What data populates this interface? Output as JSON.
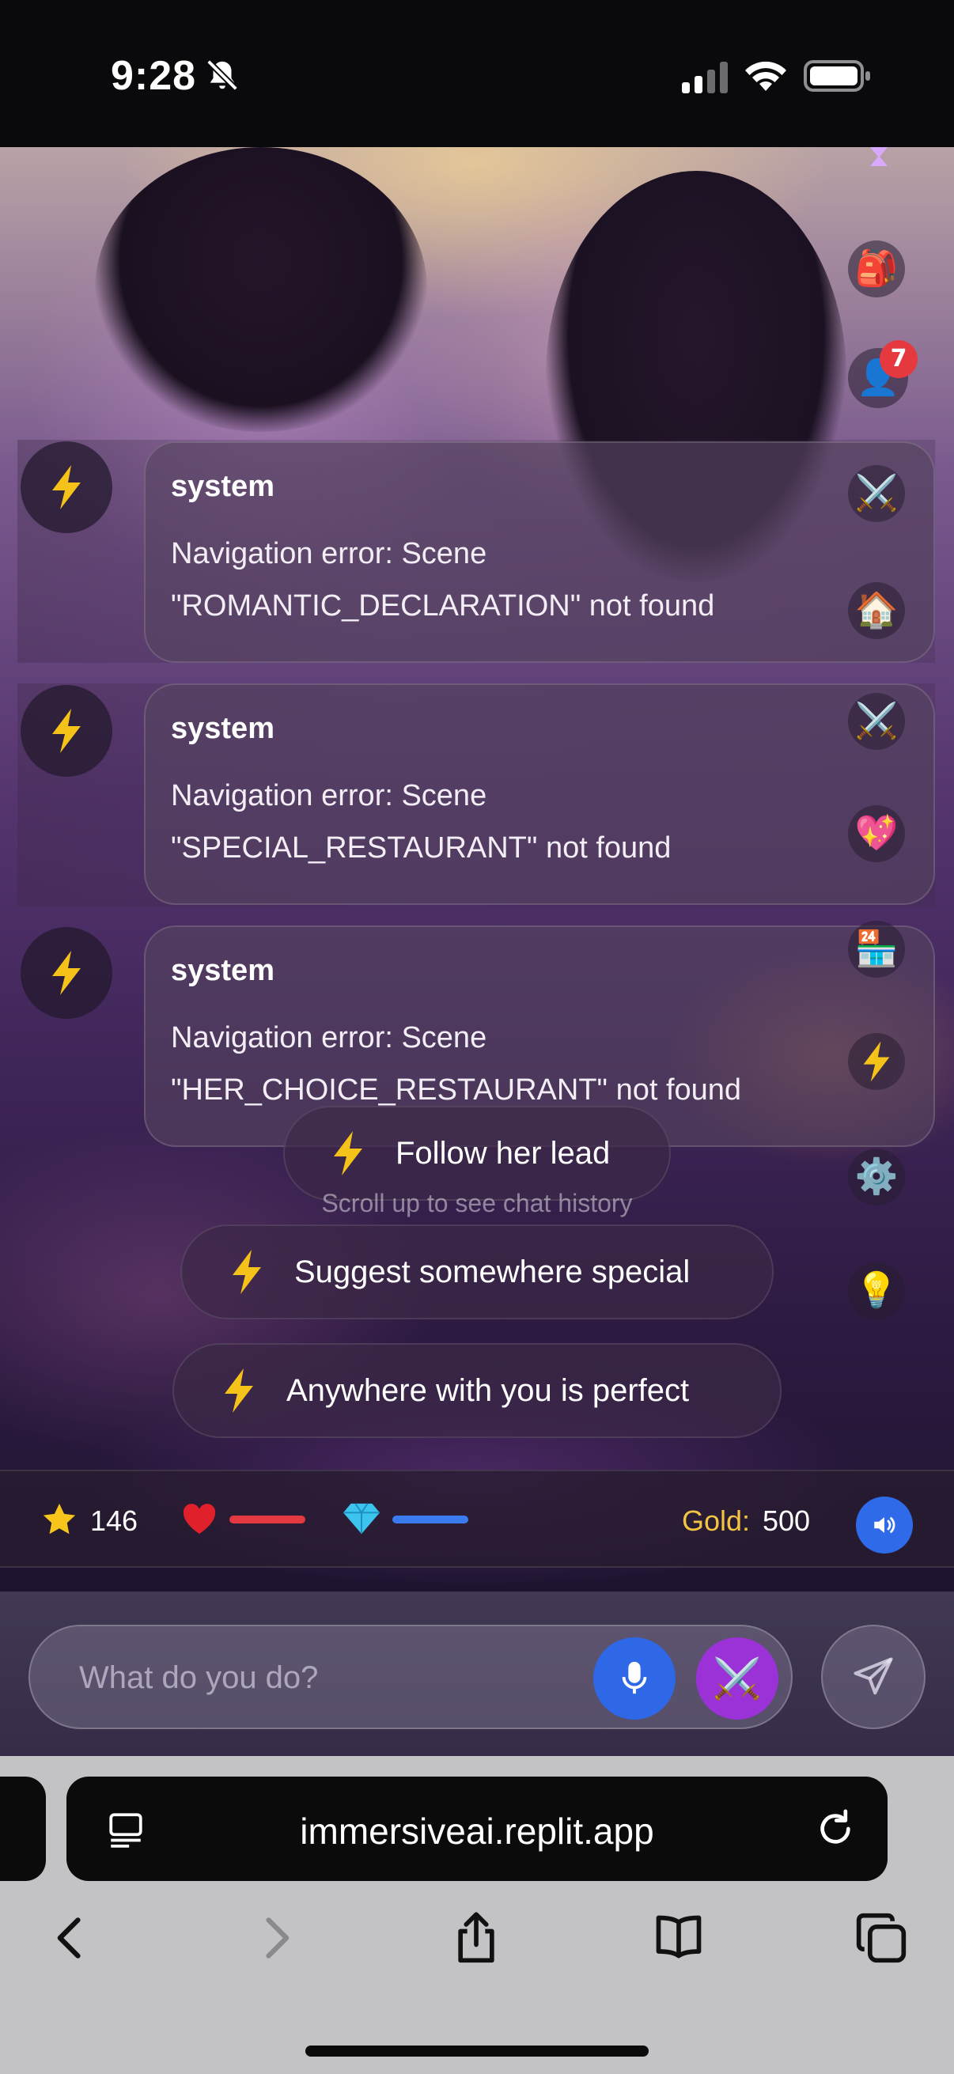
{
  "status_bar": {
    "time": "9:28"
  },
  "rail": {
    "items": [
      {
        "name": "backpack",
        "glyph": "🎒"
      },
      {
        "name": "profile",
        "glyph": "👤",
        "badge": "7"
      },
      {
        "name": "battle",
        "glyph": "⚔️"
      },
      {
        "name": "home",
        "glyph": "🏠"
      },
      {
        "name": "battle-2",
        "glyph": "⚔️"
      },
      {
        "name": "sparkling-heart",
        "glyph": "💖"
      },
      {
        "name": "convenience-store",
        "glyph": "🏪"
      },
      {
        "name": "lightning",
        "glyph": "⚡"
      },
      {
        "name": "settings",
        "glyph": "⚙️"
      },
      {
        "name": "hint",
        "glyph": "💡"
      }
    ]
  },
  "messages": [
    {
      "sender": "system",
      "line1": "Navigation error: Scene",
      "line2": "\"ROMANTIC_DECLARATION\" not found"
    },
    {
      "sender": "system",
      "line1": "Navigation error: Scene",
      "line2": "\"SPECIAL_RESTAURANT\" not found"
    },
    {
      "sender": "system",
      "line1": "Navigation error: Scene",
      "line2": "\"HER_CHOICE_RESTAURANT\" not found"
    }
  ],
  "choices": [
    {
      "label": "Follow her lead"
    },
    {
      "label": "Suggest somewhere special"
    },
    {
      "label": "Anywhere with you is perfect"
    }
  ],
  "scroll_hint": "Scroll up to see chat history",
  "stats": {
    "xp": "146",
    "health_fraction": 1.0,
    "mana_fraction": 1.0,
    "gold_label": "Gold:",
    "gold_value": "500"
  },
  "composer": {
    "placeholder": "What do you do?",
    "action_glyph": "⚔️"
  },
  "browser": {
    "url": "immersiveai.replit.app"
  },
  "colors": {
    "accent_blue": "#2f6be8",
    "accent_purple": "#9b32d8",
    "gold": "#f2c443",
    "health": "#e53941",
    "mana": "#3a7bf0",
    "bolt": "#f5c21a"
  }
}
